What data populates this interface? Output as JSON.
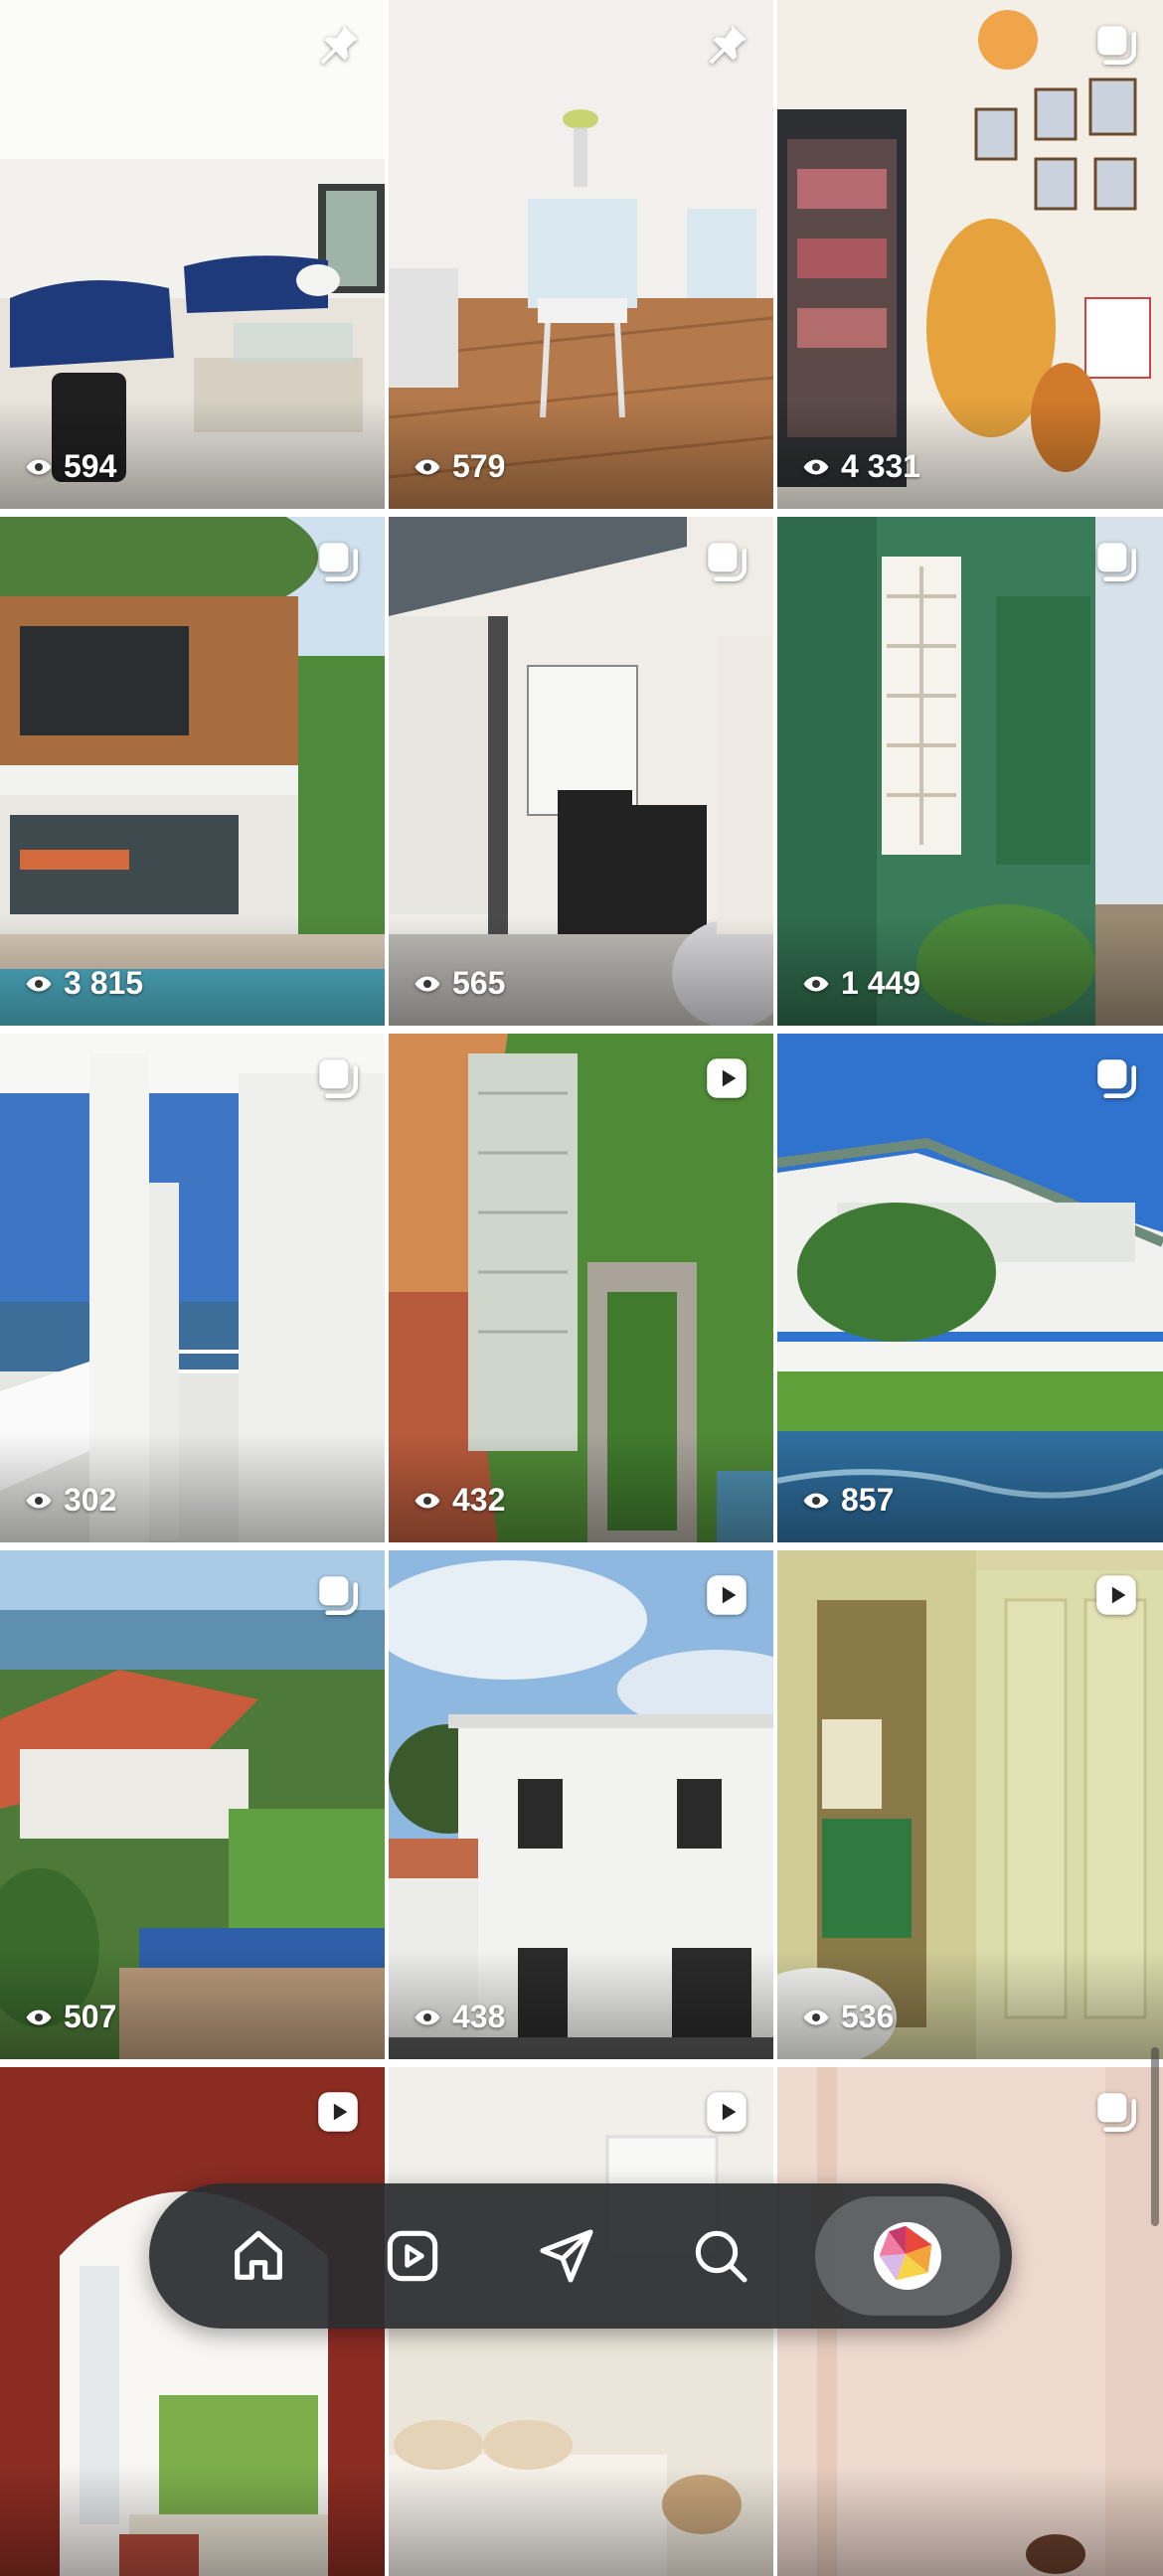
{
  "grid": {
    "tiles": [
      {
        "views": "594",
        "badge": "pin",
        "badge_icon": "pin-icon"
      },
      {
        "views": "579",
        "badge": "pin",
        "badge_icon": "pin-icon"
      },
      {
        "views": "4 331",
        "badge": "carousel",
        "badge_icon": "carousel-icon"
      },
      {
        "views": "3 815",
        "badge": "carousel",
        "badge_icon": "carousel-icon"
      },
      {
        "views": "565",
        "badge": "carousel",
        "badge_icon": "carousel-icon"
      },
      {
        "views": "1 449",
        "badge": "carousel",
        "badge_icon": "carousel-icon"
      },
      {
        "views": "302",
        "badge": "carousel",
        "badge_icon": "carousel-icon"
      },
      {
        "views": "432",
        "badge": "reel",
        "badge_icon": "reel-play-icon"
      },
      {
        "views": "857",
        "badge": "carousel",
        "badge_icon": "carousel-icon"
      },
      {
        "views": "507",
        "badge": "carousel",
        "badge_icon": "carousel-icon"
      },
      {
        "views": "438",
        "badge": "reel",
        "badge_icon": "reel-play-icon"
      },
      {
        "views": "536",
        "badge": "reel",
        "badge_icon": "reel-play-icon"
      },
      {
        "views": "",
        "badge": "reel",
        "badge_icon": "reel-play-icon"
      },
      {
        "views": "",
        "badge": "reel",
        "badge_icon": "reel-play-icon"
      },
      {
        "views": "",
        "badge": "carousel",
        "badge_icon": "carousel-icon"
      }
    ],
    "views_icon": "eye-icon"
  },
  "tab_bar": {
    "tabs": [
      {
        "name": "home",
        "icon": "home-icon"
      },
      {
        "name": "reels",
        "icon": "reels-icon"
      },
      {
        "name": "messages",
        "icon": "send-icon"
      },
      {
        "name": "search",
        "icon": "search-icon"
      },
      {
        "name": "profile",
        "icon": "profile-avatar",
        "active": true
      }
    ]
  },
  "colors": {
    "tab_bar_bg": "#2a2c2e",
    "active_tab_bg": "#787a7c",
    "icon_color": "#ffffff"
  }
}
